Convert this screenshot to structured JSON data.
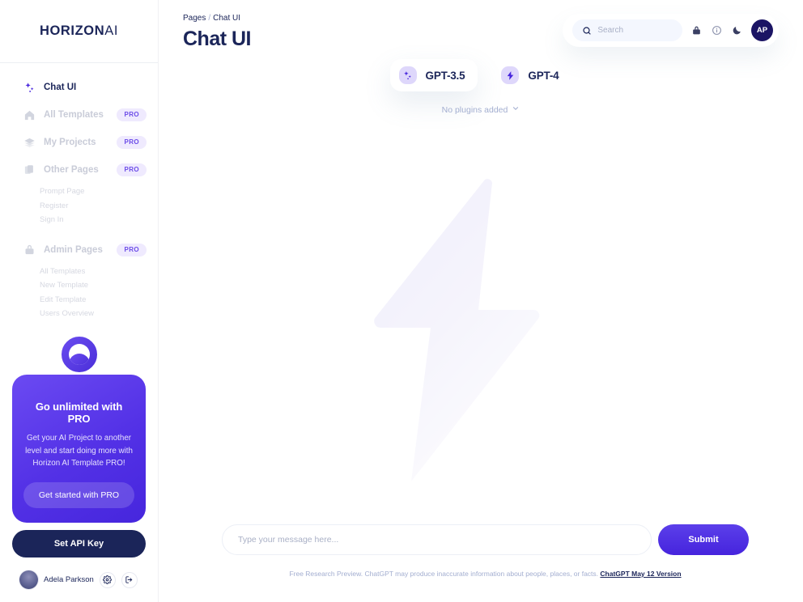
{
  "brand": {
    "name_bold": "HORIZON",
    "name_light": "AI",
    "accent": "#4624DD",
    "text_dark": "#1B2559"
  },
  "sidebar": {
    "items": [
      {
        "label": "Chat UI",
        "icon": "sparkles-icon",
        "active": true,
        "badge": null
      },
      {
        "label": "All Templates",
        "icon": "home-icon",
        "active": false,
        "badge": "PRO"
      },
      {
        "label": "My Projects",
        "icon": "layers-icon",
        "active": false,
        "badge": "PRO"
      },
      {
        "label": "Other Pages",
        "icon": "pages-icon",
        "active": false,
        "badge": "PRO"
      }
    ],
    "other_pages_sub": [
      "Prompt Page",
      "Register",
      "Sign In"
    ],
    "admin": {
      "label": "Admin Pages",
      "icon": "lock-icon",
      "badge": "PRO"
    },
    "admin_sub": [
      "All Templates",
      "New Template",
      "Edit Template",
      "Users Overview"
    ]
  },
  "pro_card": {
    "title": "Go unlimited with PRO",
    "body": "Get your AI Project to another level and start doing more with Horizon AI Template PRO!",
    "cta": "Get started with PRO",
    "api_button": "Set API Key"
  },
  "profile": {
    "name": "Adela Parkson",
    "settings_icon": "gear-icon",
    "logout_icon": "logout-icon"
  },
  "header": {
    "breadcrumb_parent": "Pages",
    "breadcrumb_sep": "/",
    "breadcrumb_current": "Chat UI",
    "page_title": "Chat UI",
    "search_placeholder": "Search",
    "search_value": "",
    "icons": [
      "lock-icon",
      "info-icon",
      "moon-icon"
    ],
    "avatar_initials": "AP"
  },
  "models": [
    {
      "label": "GPT-3.5",
      "icon": "sparkles-icon",
      "selected": true
    },
    {
      "label": "GPT-4",
      "icon": "bolt-icon",
      "selected": false
    }
  ],
  "plugins": {
    "label": "No plugins added",
    "chevron": "chevron-down-icon"
  },
  "composer": {
    "placeholder": "Type your message here...",
    "value": "",
    "submit_label": "Submit"
  },
  "disclaimer": {
    "text": "Free Research Preview. ChatGPT may produce inaccurate information about people, places, or facts.",
    "version": "ChatGPT May 12 Version"
  }
}
